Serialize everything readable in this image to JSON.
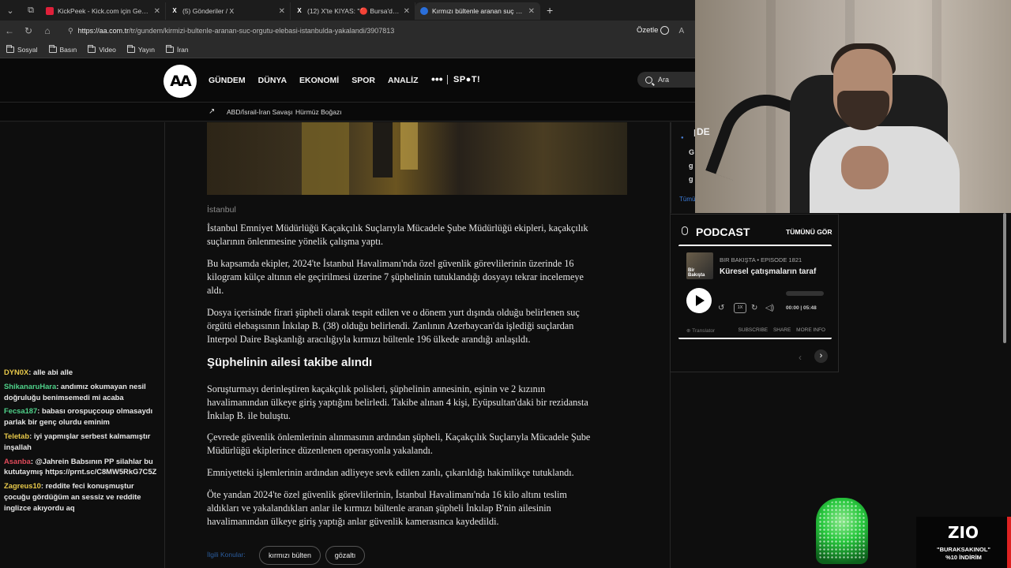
{
  "browser": {
    "tabs": [
      {
        "title": "KickPeek - Kick.com için Gerçek Za",
        "fav_color": "#e0203a",
        "fav_glyph": ""
      },
      {
        "title": "(5) Gönderiler / X",
        "fav_color": "#000000",
        "fav_glyph": "X"
      },
      {
        "title": "(12) X'te KIYAS: \"🔴 Bursa'da sosy",
        "fav_color": "#000000",
        "fav_glyph": "X"
      },
      {
        "title": "Kırmızı bültenle aranan suç örgüt",
        "fav_color": "#2a6fdb",
        "fav_glyph": ""
      }
    ],
    "new_tab_icon": "plus-icon",
    "url_host": "https://aa.com.tr",
    "url_path": "/tr/gundem/kirmizi-bultenle-aranan-suc-orgutu-elebasi-istanbulda-yakalandi/3907813",
    "summarize_label": "Özetle",
    "bookmarks": [
      "Sosyal",
      "Basın",
      "Video",
      "Yayın",
      "İran"
    ]
  },
  "site": {
    "logo_text": "AA",
    "nav": [
      "GÜNDEM",
      "DÜNYA",
      "EKONOMİ",
      "SPOR",
      "ANALİZ"
    ],
    "more": "•••",
    "spot": "SP●T!",
    "search_placeholder": "Ara",
    "trending": [
      "ABD/İsrail-İran Savaşı",
      "Hürmüz Boğazı"
    ]
  },
  "article": {
    "location": "İstanbul",
    "paragraphs": [
      "İstanbul Emniyet Müdürlüğü Kaçakçılık Suçlarıyla Mücadele Şube Müdürlüğü ekipleri, kaçakçılık suçlarının önlenmesine yönelik çalışma yaptı.",
      "Bu kapsamda ekipler, 2024'te İstanbul Havalimanı'nda özel güvenlik görevlilerinin üzerinde 16 kilogram külçe altının ele geçirilmesi üzerine 7 şüphelinin tutuklandığı dosyayı tekrar incelemeye aldı.",
      "Dosya içerisinde firari şüpheli olarak tespit edilen ve o dönem yurt dışında olduğu belirlenen suç örgütü elebaşısının İnkılap B. (38) olduğu belirlendi. Zanlının Azerbaycan'da işlediği suçlardan Interpol Daire Başkanlığı aracılığıyla kırmızı bültenle 196 ülkede arandığı anlaşıldı."
    ],
    "subheading": "Şüphelinin ailesi takibe alındı",
    "paragraphs2": [
      "Soruşturmayı derinleştiren kaçakçılık polisleri, şüphelinin annesinin, eşinin ve 2 kızının havalimanından ülkeye giriş yaptığını belirledi. Takibe alınan 4 kişi, Eyüpsultan'daki bir rezidansta İnkılap B. ile buluştu.",
      "Çevrede güvenlik önlemlerinin alınmasının ardından şüpheli, Kaçakçılık Suçlarıyla Mücadele Şube Müdürlüğü ekiplerince düzenlenen operasyonla yakalandı.",
      "Emniyetteki işlemlerinin ardından adliyeye sevk edilen zanlı, çıkarıldığı hakimlikçe tutuklandı.",
      "Öte yandan 2024'te özel güvenlik görevlilerinin, İstanbul Havalimanı'nda 16 kilo altını teslim aldıkları ve yakalandıkları anlar ile kırmızı bültenle aranan şüpheli İnkılap B'nin ailesinin havalimanından ülkeye giriş yaptığı anlar güvenlik kamerasınca kaydedildi."
    ],
    "tags_label": "İlgili Konular:",
    "tags": [
      "kırmızı bülten",
      "gözaltı"
    ]
  },
  "sidebar": {
    "top_letters": [
      "DE",
      "G",
      "g",
      "g"
    ],
    "top_dot": "●",
    "top_more": "Tümü",
    "podcast_title": "PODCAST",
    "see_all": "TÜMÜNÜ GÖR",
    "thumb_text": "Bir Bakışta",
    "episode_show": "BIR BAKIŞTA • EPISODE 1821",
    "episode_title": "Küresel çatışmaların taraf",
    "speed": "1X",
    "time": "00:00 | 05:48",
    "progress": 0,
    "translator": "Translator",
    "links": [
      "SUBSCRIBE",
      "SHARE",
      "MORE INFO"
    ]
  },
  "chat": [
    {
      "user": "DYN0X",
      "text": "alle abi alle",
      "color": "#e8c94a"
    },
    {
      "user": "ShikanaruHara",
      "text": "andımız okumayan nesil doğruluğu benimsemedi mi acaba",
      "color": "#4fd28a"
    },
    {
      "user": "Fecsa187",
      "text": "babası orospuçcoup olmasaydı parlak bir genç olurdu eminim",
      "color": "#4fd28a"
    },
    {
      "user": "Teletab",
      "text": "iyi yapmışlar serbest kalmamıştır inşallah",
      "color": "#e8c94a"
    },
    {
      "user": "Asanba",
      "text": "@Jahrein Babsının PP silahlar bu kututaymış https://prnt.sc/C8MW5RkG7C5Z",
      "color": "#e04a5a"
    },
    {
      "user": "Zagreus10",
      "text": "reddite feci konuşmuştur çocuğu gördüğüm an sessiz ve reddite inglizce akıyordu aq",
      "color": "#e8c94a"
    }
  ],
  "promo": {
    "logo": "ZIO",
    "code": "\"BURAKSAKINOL\"",
    "discount": "%10 İNDİRİM"
  },
  "webcam": {
    "label": "DE"
  }
}
